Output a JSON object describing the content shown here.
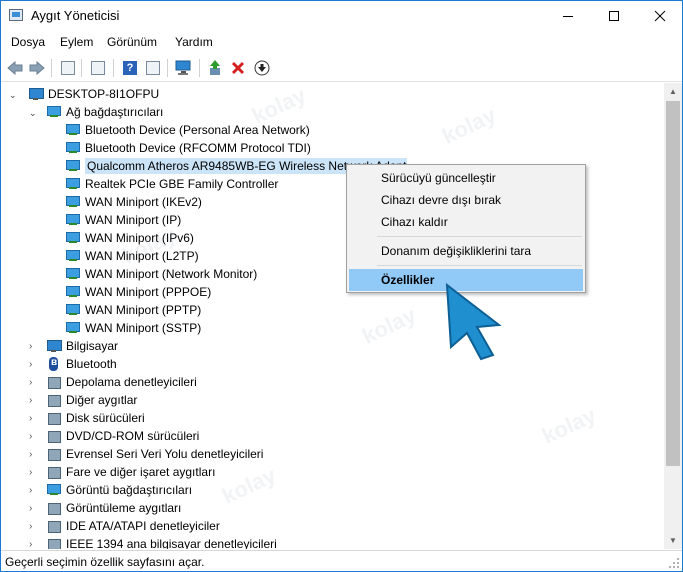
{
  "window": {
    "title": "Aygıt Yöneticisi"
  },
  "menu": {
    "items": [
      "Dosya",
      "Eylem",
      "Görünüm",
      "Yardım"
    ]
  },
  "tree": {
    "root": "DESKTOP-8I1OFPU",
    "network_category": "Ağ bağdaştırıcıları",
    "network_devices": [
      "Bluetooth Device (Personal Area Network)",
      "Bluetooth Device (RFCOMM Protocol TDI)",
      "Qualcomm Atheros AR9485WB-EG Wireless Network Adapter",
      "Realtek PCIe GBE Family Controller",
      "WAN Miniport (IKEv2)",
      "WAN Miniport (IP)",
      "WAN Miniport (IPv6)",
      "WAN Miniport (L2TP)",
      "WAN Miniport (Network Monitor)",
      "WAN Miniport (PPPOE)",
      "WAN Miniport (PPTP)",
      "WAN Miniport (SSTP)"
    ],
    "categories": [
      "Bilgisayar",
      "Bluetooth",
      "Depolama denetleyicileri",
      "Diğer aygıtlar",
      "Disk sürücüleri",
      "DVD/CD-ROM sürücüleri",
      "Evrensel Seri Veri Yolu denetleyicileri",
      "Fare ve diğer işaret aygıtları",
      "Görüntü bağdaştırıcıları",
      "Görüntüleme aygıtları",
      "IDE ATA/ATAPI denetleyiciler",
      "IEEE 1394 ana bilgisayar denetleyicileri"
    ]
  },
  "context_menu": {
    "items": [
      "Sürücüyü güncelleştir",
      "Cihazı devre dışı bırak",
      "Cihazı kaldır",
      "Donanım değişikliklerini tara",
      "Özellikler"
    ],
    "highlighted": "Özellikler"
  },
  "status": {
    "text": "Geçerli seçimin özellik sayfasını açar."
  },
  "watermark": {
    "text": "kolay"
  },
  "colors": {
    "accent": "#1e7ad1",
    "selection": "#cce4f7",
    "menu_highlight": "#91c9f7",
    "cursor": "#1f8fd0"
  }
}
